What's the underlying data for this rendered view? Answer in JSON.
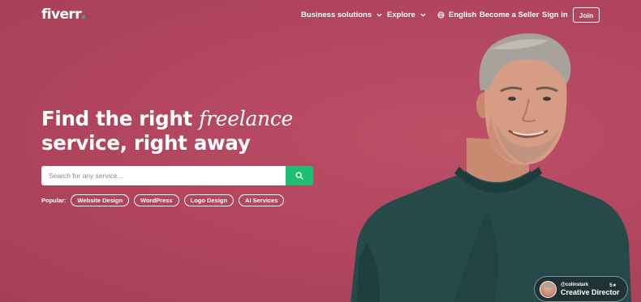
{
  "brand": {
    "logo_text": "fiverr",
    "accent": "#1dbf73",
    "background": "#b4475f"
  },
  "nav": {
    "business_solutions": "Business solutions",
    "explore": "Explore",
    "language": "English",
    "become_seller": "Become a Seller",
    "sign_in": "Sign in",
    "join": "Join"
  },
  "hero": {
    "headline_part1": "Find the right ",
    "headline_italic": "freelance",
    "headline_part2": "service, right away"
  },
  "search": {
    "placeholder": "Search for any service...",
    "button_icon": "search-icon"
  },
  "popular": {
    "label": "Popular:",
    "tags": [
      "Website Design",
      "WordPress",
      "Logo Design",
      "AI Services"
    ]
  },
  "badge": {
    "handle": "@colinstark",
    "rating": "5★",
    "role": "Creative Director"
  }
}
